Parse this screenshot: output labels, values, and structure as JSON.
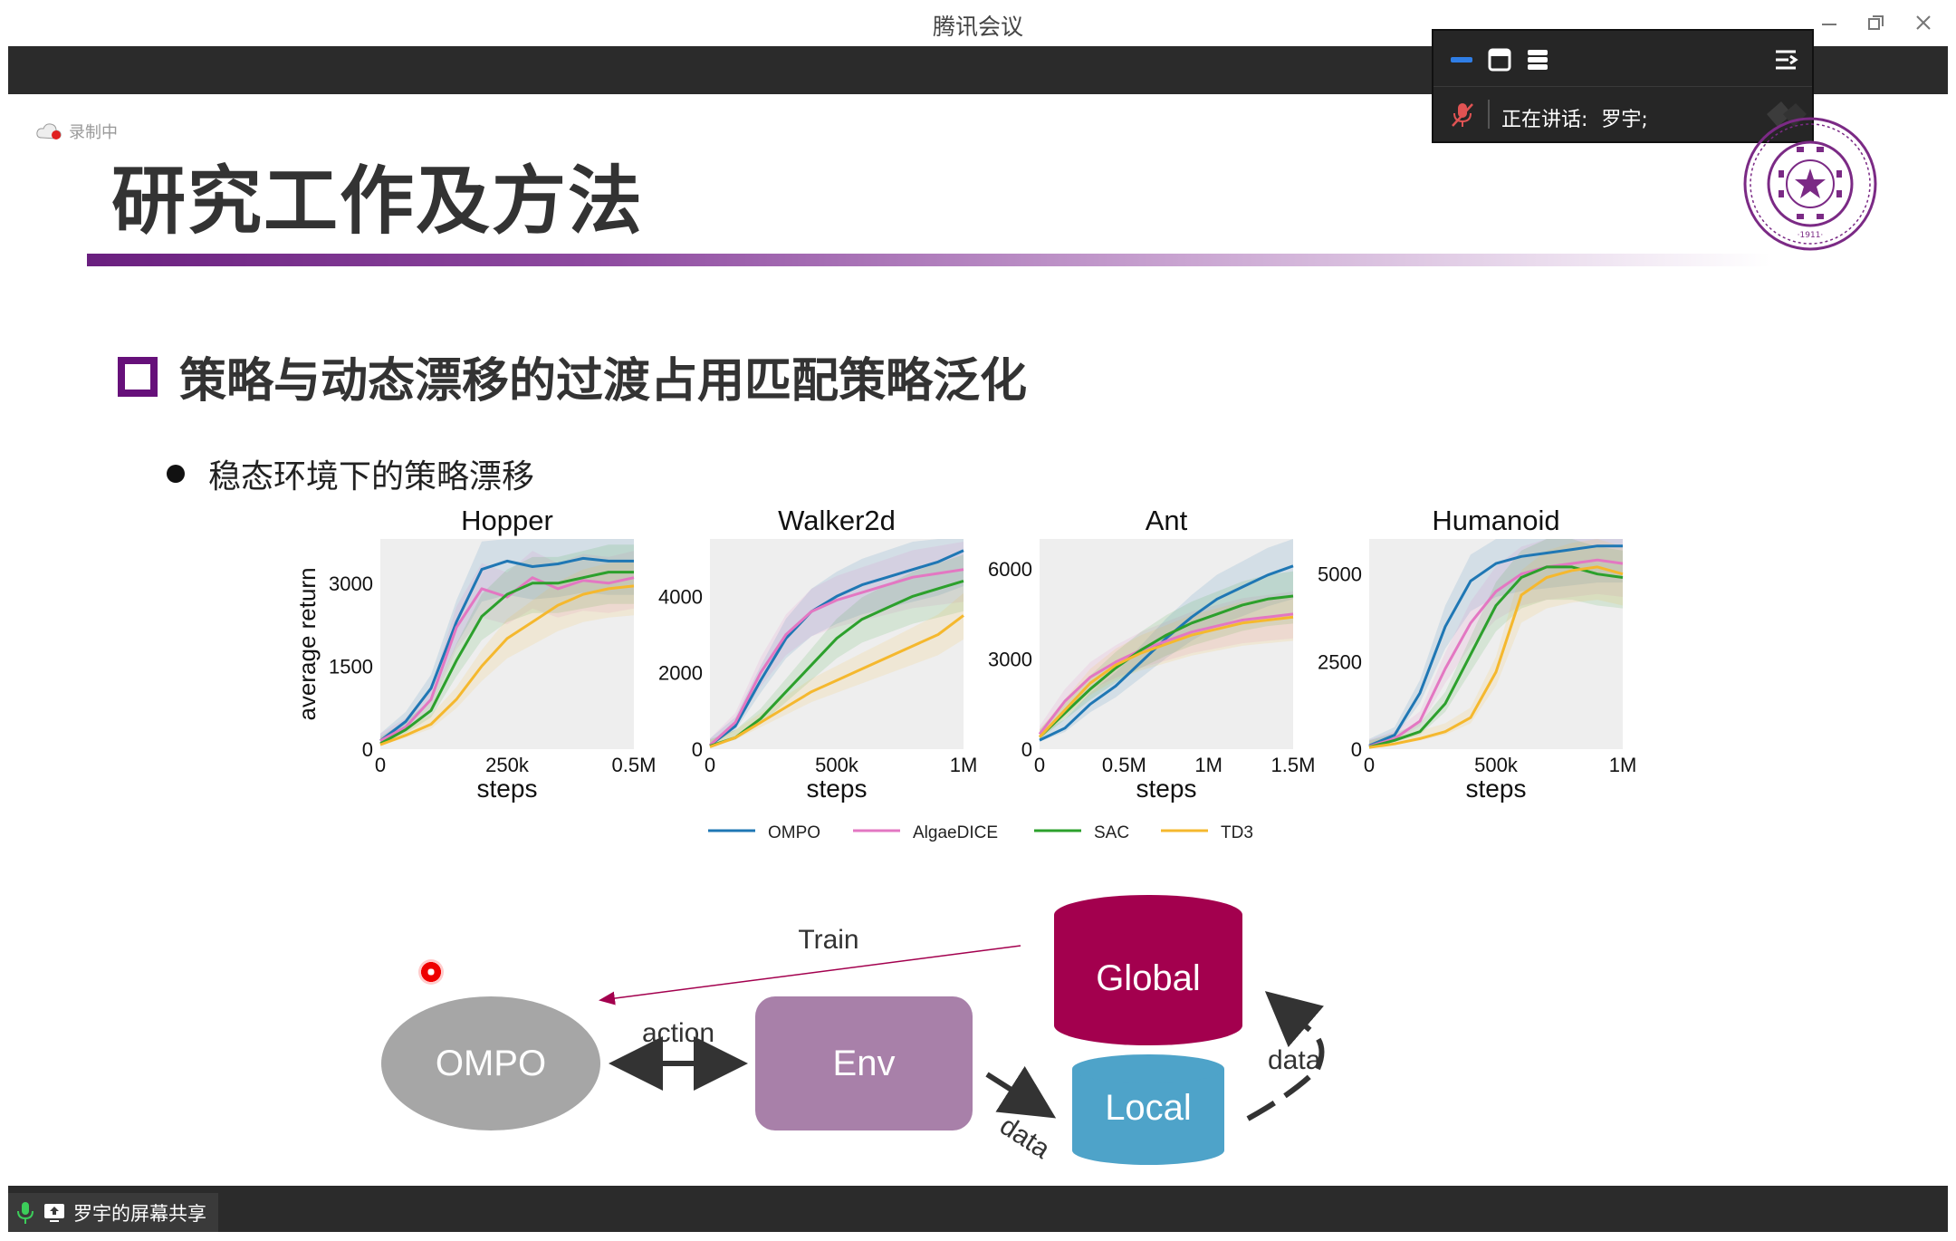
{
  "window": {
    "title": "腾讯会议"
  },
  "speaker_panel": {
    "speaking_label": "正在讲话:",
    "speaker_name": "罗宇;"
  },
  "recording": {
    "label": "录制中"
  },
  "slide": {
    "title": "研究工作及方法",
    "section": "策略与动态漂移的过渡占用匹配策略泛化",
    "bullet": "稳态环境下的策略漂移"
  },
  "colors": {
    "accent_purple": "#66107a",
    "ompo": "#1f77b4",
    "algaedice": "#e377c2",
    "sac": "#2ca02c",
    "td3": "#f5b82e",
    "global": "#a3004e",
    "local": "#4ea3c9",
    "env": "#a880a9",
    "ompo_node": "#a6a6a6"
  },
  "chart_data": [
    {
      "type": "line",
      "title": "Hopper",
      "xlabel": "steps",
      "ylabel": "average return",
      "xlim": [
        0,
        500000
      ],
      "ylim": [
        0,
        3800
      ],
      "xticks": [
        "0",
        "250k",
        "0.5M"
      ],
      "yticks": [
        "0",
        "1500",
        "3000"
      ],
      "x": [
        0,
        50000,
        100000,
        150000,
        200000,
        250000,
        300000,
        350000,
        400000,
        450000,
        500000
      ],
      "series": [
        {
          "name": "OMPO",
          "values": [
            150,
            500,
            1100,
            2300,
            3250,
            3400,
            3300,
            3350,
            3450,
            3400,
            3400
          ]
        },
        {
          "name": "AlgaeDICE",
          "values": [
            150,
            400,
            900,
            2200,
            2900,
            2750,
            3100,
            2900,
            3050,
            3000,
            3100
          ]
        },
        {
          "name": "SAC",
          "values": [
            100,
            350,
            700,
            1600,
            2400,
            2800,
            3000,
            3000,
            3100,
            3200,
            3200
          ]
        },
        {
          "name": "TD3",
          "values": [
            80,
            250,
            450,
            900,
            1500,
            2000,
            2300,
            2600,
            2800,
            2900,
            2950
          ]
        }
      ]
    },
    {
      "type": "line",
      "title": "Walker2d",
      "xlabel": "steps",
      "ylabel": "",
      "xlim": [
        0,
        1000000
      ],
      "ylim": [
        0,
        5500
      ],
      "xticks": [
        "0",
        "500k",
        "1M"
      ],
      "yticks": [
        "0",
        "2000",
        "4000"
      ],
      "x": [
        0,
        100000,
        200000,
        300000,
        400000,
        500000,
        600000,
        700000,
        800000,
        900000,
        1000000
      ],
      "series": [
        {
          "name": "OMPO",
          "values": [
            100,
            600,
            1800,
            2900,
            3600,
            4000,
            4300,
            4500,
            4700,
            4900,
            5200
          ]
        },
        {
          "name": "AlgaeDICE",
          "values": [
            100,
            700,
            2000,
            3000,
            3600,
            3900,
            4100,
            4300,
            4500,
            4600,
            4700
          ]
        },
        {
          "name": "SAC",
          "values": [
            80,
            300,
            800,
            1500,
            2200,
            2900,
            3400,
            3700,
            4000,
            4200,
            4400
          ]
        },
        {
          "name": "TD3",
          "values": [
            60,
            300,
            700,
            1100,
            1500,
            1800,
            2100,
            2400,
            2700,
            3000,
            3500
          ]
        }
      ]
    },
    {
      "type": "line",
      "title": "Ant",
      "xlabel": "steps",
      "ylabel": "",
      "xlim": [
        0,
        1500000
      ],
      "ylim": [
        0,
        7000
      ],
      "xticks": [
        "0",
        "0.5M",
        "1M",
        "1.5M"
      ],
      "yticks": [
        "0",
        "3000",
        "6000"
      ],
      "x": [
        0,
        150000,
        300000,
        450000,
        600000,
        750000,
        900000,
        1050000,
        1200000,
        1350000,
        1500000
      ],
      "series": [
        {
          "name": "OMPO",
          "values": [
            300,
            700,
            1500,
            2100,
            2900,
            3700,
            4400,
            5000,
            5400,
            5800,
            6100
          ]
        },
        {
          "name": "AlgaeDICE",
          "values": [
            500,
            1600,
            2400,
            2900,
            3300,
            3600,
            3900,
            4100,
            4300,
            4400,
            4500
          ]
        },
        {
          "name": "SAC",
          "values": [
            400,
            1200,
            2000,
            2700,
            3300,
            3800,
            4200,
            4500,
            4800,
            5000,
            5100
          ]
        },
        {
          "name": "TD3",
          "values": [
            400,
            1300,
            2200,
            2800,
            3200,
            3500,
            3800,
            4000,
            4200,
            4300,
            4400
          ]
        }
      ]
    },
    {
      "type": "line",
      "title": "Humanoid",
      "xlabel": "steps",
      "ylabel": "",
      "xlim": [
        0,
        1000000
      ],
      "ylim": [
        0,
        6000
      ],
      "xticks": [
        "0",
        "500k",
        "1M"
      ],
      "yticks": [
        "0",
        "2500",
        "5000"
      ],
      "x": [
        0,
        100000,
        200000,
        300000,
        400000,
        500000,
        600000,
        700000,
        800000,
        900000,
        1000000
      ],
      "series": [
        {
          "name": "OMPO",
          "values": [
            100,
            400,
            1600,
            3500,
            4800,
            5300,
            5500,
            5600,
            5700,
            5800,
            5800
          ]
        },
        {
          "name": "AlgaeDICE",
          "values": [
            80,
            300,
            800,
            2300,
            3600,
            4500,
            5000,
            5200,
            5300,
            5400,
            5300
          ]
        },
        {
          "name": "SAC",
          "values": [
            60,
            250,
            500,
            1300,
            2700,
            4100,
            4900,
            5200,
            5200,
            5000,
            4900
          ]
        },
        {
          "name": "TD3",
          "values": [
            50,
            150,
            300,
            500,
            900,
            2200,
            4400,
            4900,
            5100,
            5200,
            5000
          ]
        }
      ]
    }
  ],
  "legend": [
    "OMPO",
    "AlgaeDICE",
    "SAC",
    "TD3"
  ],
  "diagram": {
    "ompo": "OMPO",
    "env": "Env",
    "global": "Global",
    "local": "Local",
    "train": "Train",
    "action": "action",
    "data_env": "data",
    "data_loop": "data"
  },
  "bottom": {
    "share_label": "罗宇的屏幕共享"
  }
}
